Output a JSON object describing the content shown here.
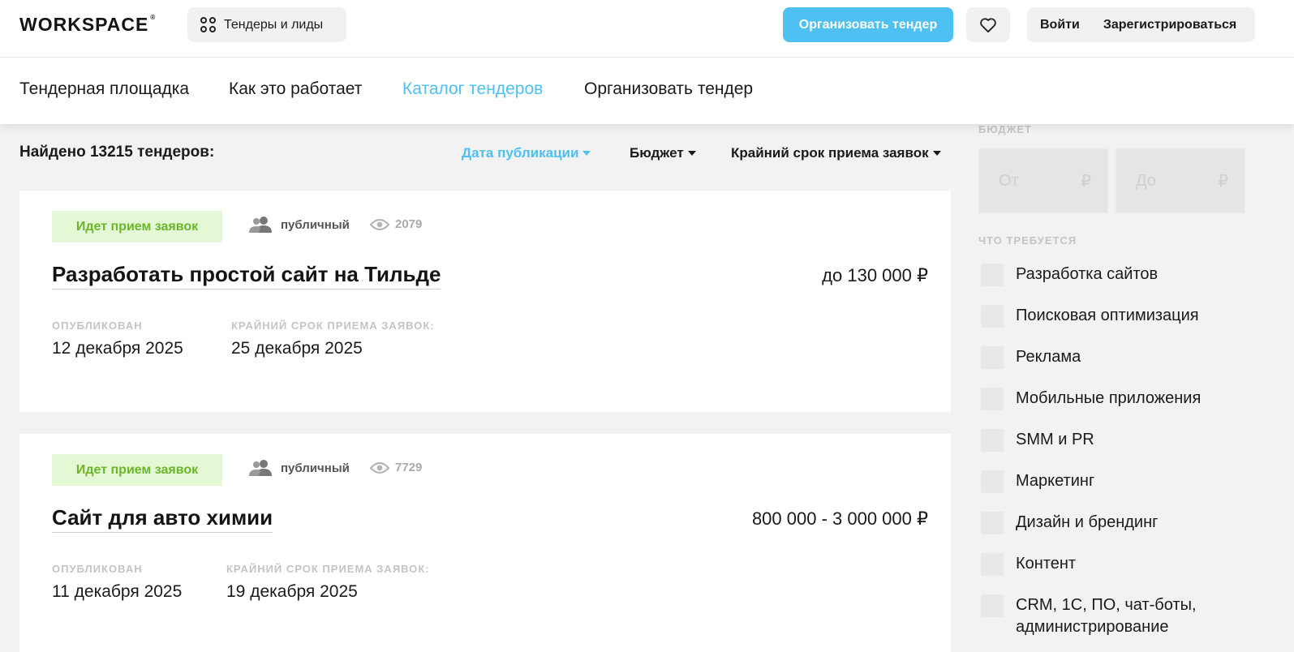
{
  "header": {
    "logo_text": "WORKSPACE",
    "tenders_button": "Тендеры и лиды",
    "organize_button": "Организовать тендер",
    "login": "Войти",
    "register": "Зарегистрироваться"
  },
  "nav": {
    "items": [
      {
        "label": "Тендерная площадка"
      },
      {
        "label": "Как это работает"
      },
      {
        "label": "Каталог тендеров"
      },
      {
        "label": "Организовать тендер"
      }
    ],
    "active_index": 2
  },
  "results": {
    "found_text": "Найдено 13215 тендеров:",
    "sort": {
      "by_date": "Дата публикации",
      "by_budget": "Бюджет",
      "by_deadline": "Крайний срок приема заявок"
    }
  },
  "tenders": [
    {
      "status": "Идет прием заявок",
      "type": "публичный",
      "views": "2079",
      "title": "Разработать простой сайт на Тильде",
      "budget": "до 130 000 ₽",
      "published_label": "ОПУБЛИКОВАН",
      "published": "12 декабря 2025",
      "deadline_label": "КРАЙНИЙ СРОК ПРИЕМА ЗАЯВОК:",
      "deadline": "25 декабря 2025"
    },
    {
      "status": "Идет прием заявок",
      "type": "публичный",
      "views": "7729",
      "title": "Сайт для авто химии",
      "budget": "800 000 - 3 000 000 ₽",
      "published_label": "ОПУБЛИКОВАН",
      "published": "11 декабря 2025",
      "deadline_label": "КРАЙНИЙ СРОК ПРИЕМА ЗАЯВОК:",
      "deadline": "19 декабря 2025"
    }
  ],
  "sidebar": {
    "budget_label": "БЮДЖЕТ",
    "from_placeholder": "От",
    "to_placeholder": "До",
    "currency": "₽",
    "required_label": "ЧТО ТРЕБУЕТСЯ",
    "categories": [
      {
        "label": "Разработка сайтов"
      },
      {
        "label": "Поисковая оптимизация"
      },
      {
        "label": "Реклама"
      },
      {
        "label": "Мобильные приложения"
      },
      {
        "label": "SMM и PR"
      },
      {
        "label": "Маркетинг"
      },
      {
        "label": "Дизайн и брендинг"
      },
      {
        "label": "Контент"
      },
      {
        "label": "CRM, 1С, ПО, чат-боты, администрирование"
      }
    ]
  },
  "colors": {
    "accent": "#4ec0f2",
    "status_bg": "#e4f8d5",
    "status_text": "#6bb52a"
  }
}
